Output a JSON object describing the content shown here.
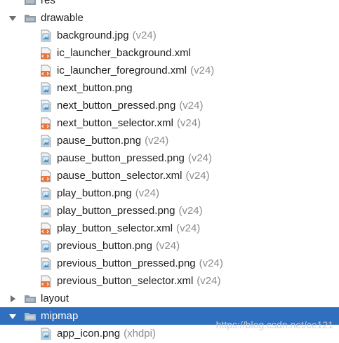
{
  "tree": {
    "top_partial_label": "res",
    "drawable": {
      "label": "drawable",
      "state": "expanded",
      "files": [
        {
          "name": "background.jpg",
          "qualifier": "(v24)",
          "type": "image"
        },
        {
          "name": "ic_launcher_background.xml",
          "qualifier": "",
          "type": "xml"
        },
        {
          "name": "ic_launcher_foreground.xml",
          "qualifier": "(v24)",
          "type": "xml"
        },
        {
          "name": "next_button.png",
          "qualifier": "",
          "type": "image"
        },
        {
          "name": "next_button_pressed.png",
          "qualifier": "(v24)",
          "type": "image"
        },
        {
          "name": "next_button_selector.xml",
          "qualifier": "(v24)",
          "type": "xml"
        },
        {
          "name": "pause_button.png",
          "qualifier": "(v24)",
          "type": "image"
        },
        {
          "name": "pause_button_pressed.png",
          "qualifier": "(v24)",
          "type": "image"
        },
        {
          "name": "pause_button_selector.xml",
          "qualifier": "(v24)",
          "type": "xml"
        },
        {
          "name": "play_button.png",
          "qualifier": "(v24)",
          "type": "image"
        },
        {
          "name": "play_button_pressed.png",
          "qualifier": "(v24)",
          "type": "image"
        },
        {
          "name": "play_button_selector.xml",
          "qualifier": "(v24)",
          "type": "xml"
        },
        {
          "name": "previous_button.png",
          "qualifier": "(v24)",
          "type": "image"
        },
        {
          "name": "previous_button_pressed.png",
          "qualifier": "(v24)",
          "type": "image"
        },
        {
          "name": "previous_button_selector.xml",
          "qualifier": "(v24)",
          "type": "xml"
        }
      ]
    },
    "layout": {
      "label": "layout",
      "state": "collapsed"
    },
    "mipmap": {
      "label": "mipmap",
      "state": "expanded",
      "selected": true,
      "files": [
        {
          "name": "app_icon.png",
          "qualifier": "(xhdpi)",
          "type": "image"
        }
      ]
    }
  },
  "watermark": "https://blog.csdn.net/ce121",
  "colors": {
    "selection": "#2f6fbe",
    "qualifier_text": "#8c8c8c",
    "xml_icon": "#e8743b",
    "image_icon": "#4a90c4",
    "folder": "#8b9aa8"
  },
  "icons": {
    "expanded_arrow": "chevron-down-icon",
    "collapsed_arrow": "chevron-right-icon",
    "folder": "folder-icon",
    "image_file": "image-file-icon",
    "xml_file": "xml-file-icon"
  }
}
